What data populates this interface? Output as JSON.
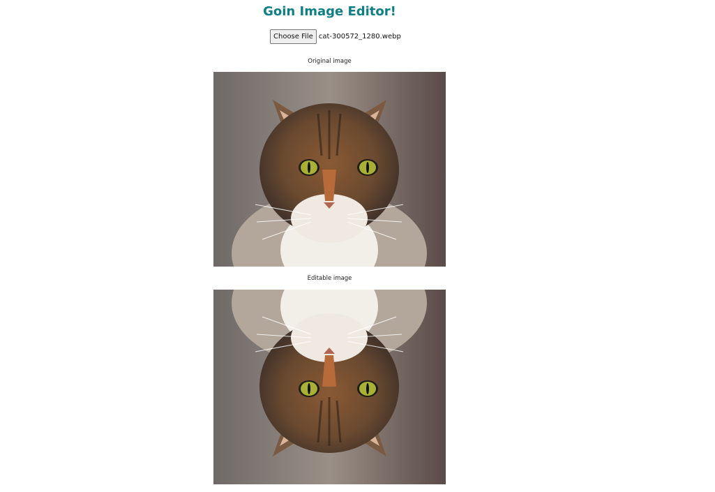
{
  "title": "Goin Image Editor!",
  "file_input": {
    "button_label": "Choose File",
    "file_name": "cat-300572_1280.webp"
  },
  "original": {
    "caption": "Original image"
  },
  "editable": {
    "caption": "Editable image"
  },
  "colors": {
    "title": "#0f7f86"
  }
}
